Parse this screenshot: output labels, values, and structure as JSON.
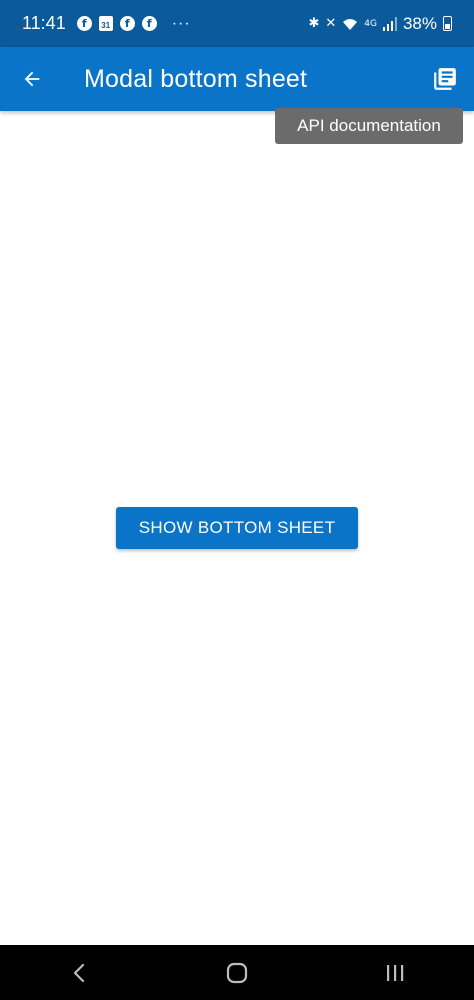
{
  "status_bar": {
    "time": "11:41",
    "calendar_day": "31",
    "more_dots": "···",
    "battery_percent": "38%",
    "network_label": "4G"
  },
  "app_bar": {
    "title": "Modal bottom sheet",
    "background_color": "#0a74c9",
    "back_icon": "arrow-back-icon",
    "doc_icon": "library-books-icon"
  },
  "tooltip": {
    "text": "API documentation"
  },
  "main": {
    "show_button_label": "SHOW BOTTOM SHEET"
  },
  "nav_bar": {
    "icons": [
      "back-icon",
      "home-icon",
      "recents-icon"
    ]
  }
}
